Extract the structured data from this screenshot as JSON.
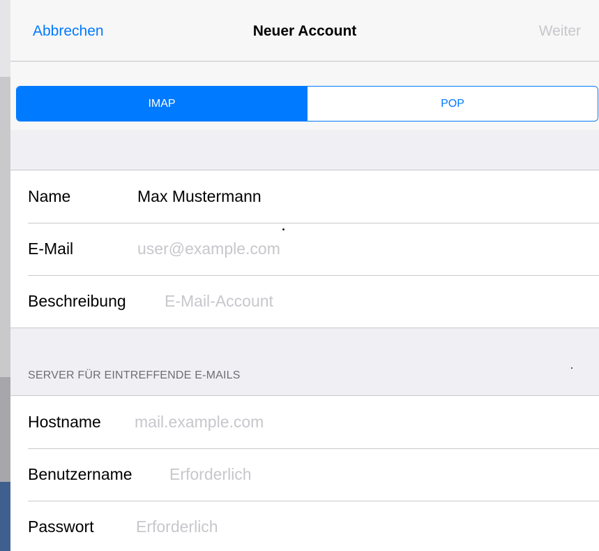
{
  "navbar": {
    "cancel_label": "Abbrechen",
    "title": "Neuer Account",
    "next_label": "Weiter"
  },
  "account_type": {
    "options": [
      "IMAP",
      "POP"
    ],
    "selected": "IMAP"
  },
  "account_fields": [
    {
      "label": "Name",
      "value": "Max Mustermann",
      "placeholder": ""
    },
    {
      "label": "E-Mail",
      "value": "",
      "placeholder": "user@example.com"
    },
    {
      "label": "Beschreibung",
      "value": "",
      "placeholder": "E-Mail-Account"
    }
  ],
  "incoming_server": {
    "section_title": "SERVER FÜR EINTREFFENDE E-MAILS",
    "fields": [
      {
        "label": "Hostname",
        "value": "",
        "placeholder": "mail.example.com"
      },
      {
        "label": "Benutzername",
        "value": "",
        "placeholder": "Erforderlich"
      },
      {
        "label": "Passwort",
        "value": "",
        "placeholder": "Erforderlich"
      }
    ]
  },
  "colors": {
    "accent": "#007aff",
    "disabled": "#c7c7cc",
    "separator": "#c8c7cc",
    "grouped_background": "#efeff4"
  }
}
